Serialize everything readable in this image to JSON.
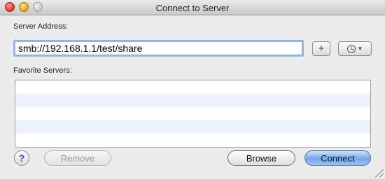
{
  "window": {
    "title": "Connect to Server"
  },
  "server_address": {
    "label": "Server Address:",
    "value": "smb://192.168.1.1/test/share"
  },
  "favorites": {
    "label": "Favorite Servers:",
    "items": []
  },
  "buttons": {
    "add": "+",
    "help": "?",
    "remove": "Remove",
    "browse": "Browse",
    "connect": "Connect"
  },
  "icons": {
    "add": "plus-icon",
    "recent": "clock-icon",
    "dropdown": "chevron-down-icon",
    "help": "question-mark-icon"
  },
  "colors": {
    "focus_ring": "#8fb6e6",
    "default_button": "#74a7e8",
    "list_stripe": "#edf3fe"
  }
}
